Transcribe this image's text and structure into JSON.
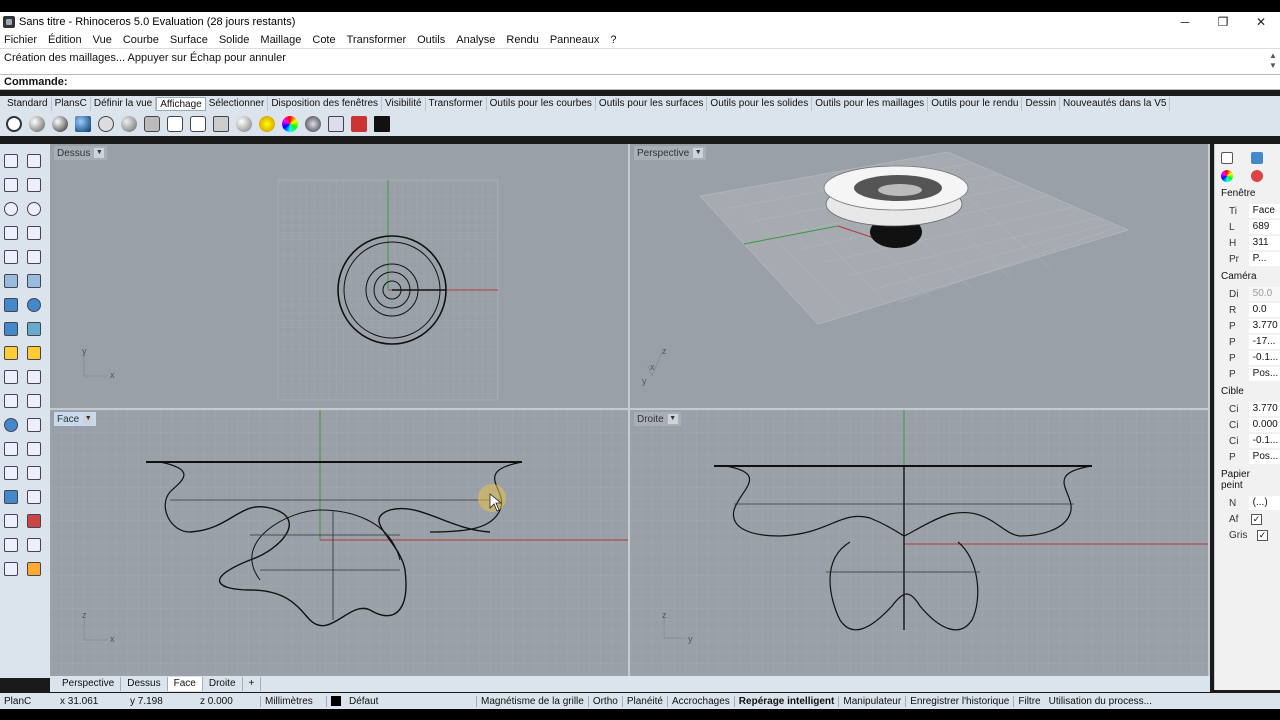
{
  "window": {
    "title": "Sans titre - Rhinoceros 5.0 Evaluation (28 jours restants)",
    "minimize": "─",
    "restore": "❐",
    "close": "✕"
  },
  "menu": [
    "Fichier",
    "Édition",
    "Vue",
    "Courbe",
    "Surface",
    "Solide",
    "Maillage",
    "Cote",
    "Transformer",
    "Outils",
    "Analyse",
    "Rendu",
    "Panneaux",
    "?"
  ],
  "history_text": "Création des maillages... Appuyer sur Échap pour annuler",
  "command": {
    "label": "Commande:",
    "value": ""
  },
  "toolbar_tabs": [
    "Standard",
    "PlansC",
    "Définir la vue",
    "Affichage",
    "Sélectionner",
    "Disposition des fenêtres",
    "Visibilité",
    "Transformer",
    "Outils pour les courbes",
    "Outils pour les surfaces",
    "Outils pour les solides",
    "Outils pour les maillages",
    "Outils pour le rendu",
    "Dessin",
    "Nouveautés dans la V5"
  ],
  "active_toolbar_tab": "Affichage",
  "viewports": {
    "top": {
      "name": "Dessus",
      "axis1": "y",
      "axis2": "x"
    },
    "perspective": {
      "name": "Perspective",
      "axis1": "z",
      "axis2": "x",
      "axis3": "y"
    },
    "front": {
      "name": "Face",
      "axis1": "z",
      "axis2": "x"
    },
    "right": {
      "name": "Droite",
      "axis1": "z",
      "axis2": "y"
    }
  },
  "properties": {
    "sections": {
      "window": "Fenêtre",
      "camera": "Caméra",
      "target": "Cible",
      "wallpaper": "Papier peint"
    },
    "window_rows": [
      {
        "k": "Ti",
        "v": "Face"
      },
      {
        "k": "L",
        "v": "689"
      },
      {
        "k": "H",
        "v": "311"
      },
      {
        "k": "Pr",
        "v": "P..."
      }
    ],
    "camera_rows": [
      {
        "k": "Di",
        "v": "50.0",
        "grey": true
      },
      {
        "k": "R",
        "v": "0.0"
      },
      {
        "k": "P",
        "v": "3.770"
      },
      {
        "k": "P",
        "v": "-17..."
      },
      {
        "k": "P",
        "v": "-0.1..."
      },
      {
        "k": "P",
        "v": "Pos..."
      }
    ],
    "target_rows": [
      {
        "k": "Ci",
        "v": "3.770"
      },
      {
        "k": "Ci",
        "v": "0.000"
      },
      {
        "k": "Ci",
        "v": "-0.1..."
      },
      {
        "k": "P",
        "v": "Pos..."
      }
    ],
    "wallpaper_rows": [
      {
        "k": "N",
        "v": "(...)"
      },
      {
        "k": "Af",
        "check": "✓"
      },
      {
        "k": "Gris",
        "check": "✓"
      }
    ]
  },
  "viewport_tabs": [
    "Perspective",
    "Dessus",
    "Face",
    "Droite",
    "+"
  ],
  "active_viewport_tab": "Face",
  "status": {
    "plane": "PlanC",
    "x": "x 31.061",
    "y": "y 7.198",
    "z": "z 0.000",
    "units": "Millimètres",
    "layer": "Défaut",
    "snap": "Magnétisme de la grille",
    "ortho": "Ortho",
    "planar": "Planéité",
    "osnap": "Accrochages",
    "smarttrack": "Repérage intelligent",
    "gumball": "Manipulateur",
    "history": "Enregistrer l'historique",
    "filter": "Filtre",
    "process": "Utilisation du process..."
  },
  "colors": {
    "viewport_bg": "#9aa0a8",
    "grid": "#a9aeb5",
    "x_axis": "#b33a3a",
    "y_axis": "#3a9a3a",
    "curve": "#111111"
  }
}
